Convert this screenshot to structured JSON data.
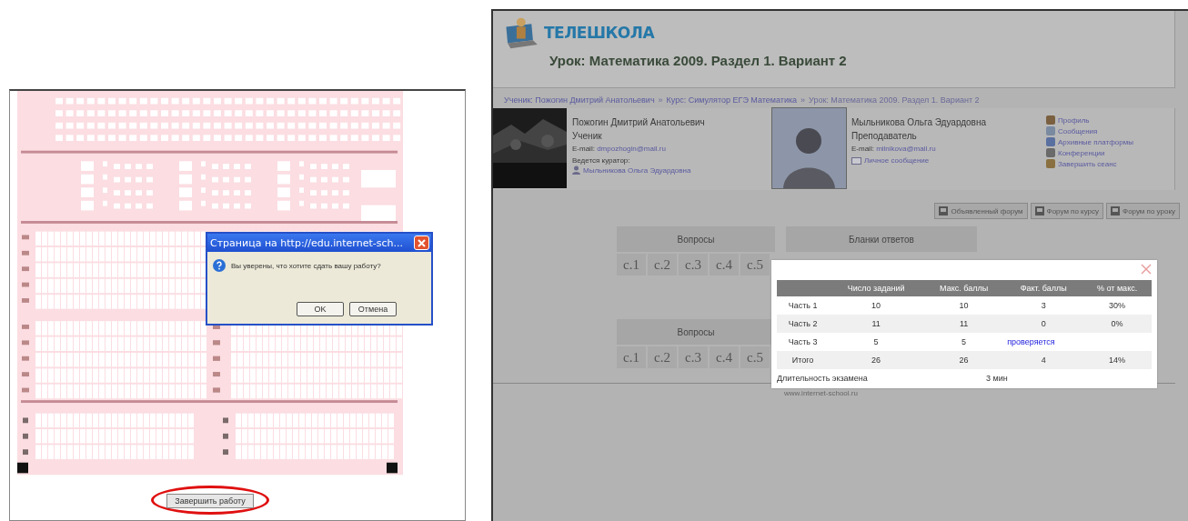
{
  "exam_window": {
    "dialog": {
      "title": "Страница на http://edu.internet-sch...",
      "message": "Вы уверены, что хотите сдать вашу работу?",
      "buttons": [
        "OK",
        "Отмена"
      ]
    },
    "submit_button": "Завершить работу"
  },
  "school_page": {
    "logo": "ТЕЛЕШКОЛА",
    "title": "Урок: Математика 2009. Раздел 1. Вариант 2",
    "breadcrumb": {
      "separator": "»",
      "items": [
        "Ученик: Пожогин Дмитрий Анатольевич",
        "Курс: Симулятор ЕГЭ Математика",
        "Урок: Математика 2009. Раздел 1. Вариант 2"
      ]
    },
    "student": {
      "name": "Пожогин Дмитрий Анатольевич",
      "role": "Ученик",
      "email_label": "E-mail:",
      "email": "dmpozhogin@mail.ru",
      "curator_label": "Ведется куратор:",
      "curator": "Мыльникова Ольга Эдуардовна"
    },
    "teacher": {
      "name": "Мыльникова Ольга Эдуардовна",
      "role": "Преподаватель",
      "email_label": "E-mail:",
      "email": "milnikova@mail.ru",
      "message_link": "Личное сообщение"
    },
    "user_menu": [
      "Профиль",
      "Сообщения",
      "Архивные платформы",
      "Конференции",
      "Завершить сеанс"
    ],
    "forum_buttons": [
      "Объявленный форум",
      "Форум по курсу",
      "Форум по уроку"
    ],
    "sections": [
      {
        "tabs": [
          "Вопросы",
          "Бланки ответов"
        ],
        "pages": [
          "с.1",
          "с.2",
          "с.3",
          "с.4",
          "с.5"
        ]
      },
      {
        "tabs": [
          "Вопросы"
        ],
        "pages": [
          "с.1",
          "с.2",
          "с.3",
          "с.4",
          "с.5"
        ]
      }
    ],
    "footer": "www.internet-school.ru",
    "results": {
      "columns": [
        "Число заданий",
        "Макс. баллы",
        "Факт. баллы",
        "% от макс."
      ],
      "rows": [
        {
          "label": "Часть 1",
          "count": "10",
          "max": "10",
          "fact": "3",
          "percent": "30%"
        },
        {
          "label": "Часть 2",
          "count": "11",
          "max": "11",
          "fact": "0",
          "percent": "0%"
        },
        {
          "label": "Часть 3",
          "count": "5",
          "max": "5",
          "status": "проверяется"
        },
        {
          "label": "Итого",
          "count": "26",
          "max": "26",
          "fact": "4",
          "percent": "14%"
        }
      ],
      "duration_label": "Длительность экзамена",
      "duration": "3 мин"
    }
  }
}
